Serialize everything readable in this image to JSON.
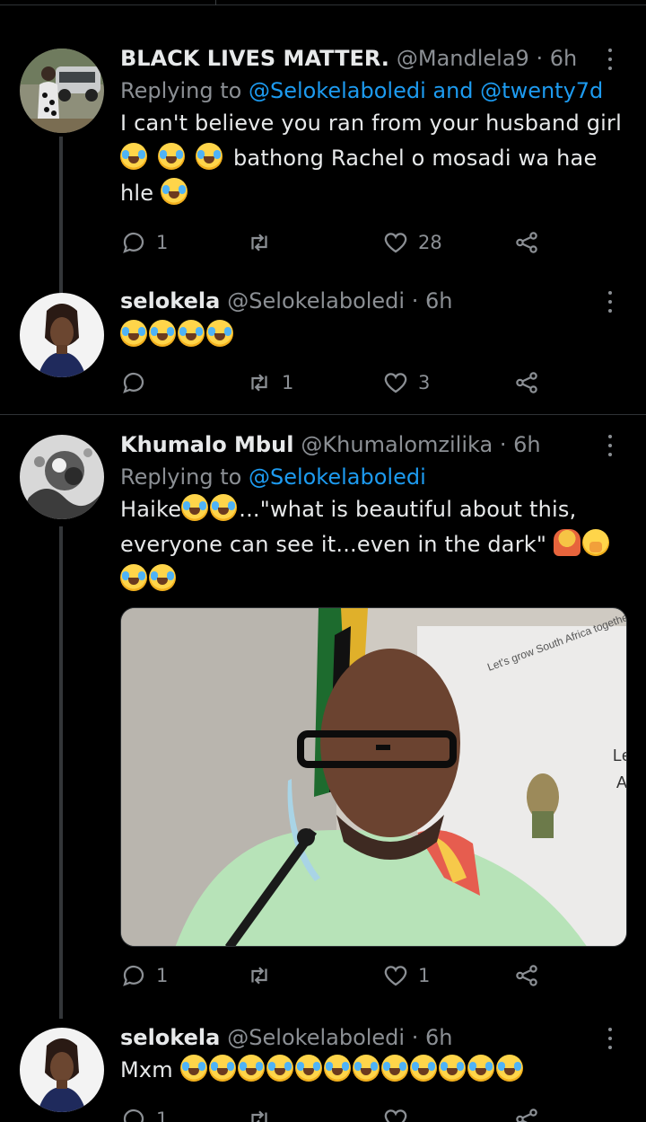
{
  "tweets": [
    {
      "name": "BLACK LIVES MATTER.",
      "handle": "@Mandlela9 · 6h",
      "reply_prefix": "Replying to",
      "reply_mentions": "@Selokelaboledi and @twenty7d",
      "line1": "I can't believe you ran from your husband girl",
      "line2_text": "bathong Rachel o mosadi wa hae",
      "line3_text": "hle",
      "replies": "1",
      "retweets": "",
      "likes": "28"
    },
    {
      "name": "selokela",
      "handle": "@Selokelaboledi · 6h",
      "replies": "",
      "retweets": "1",
      "likes": "3"
    },
    {
      "name": "Khumalo Mbul",
      "handle": "@Khumalomzilika · 6h",
      "reply_prefix": "Replying to",
      "reply_mentions": "@Selokelaboledi",
      "line1_start": "Haike",
      "line1_end": "...\"what is beautiful about this,",
      "line2": "everyone can see it...even in the dark\"",
      "image_text_1": "Let's grow South Africa together",
      "image_text_2": "Le",
      "image_text_3": "A",
      "replies": "1",
      "retweets": "",
      "likes": "1"
    },
    {
      "name": "selokela",
      "handle": "@Selokelaboledi · 6h",
      "text": "Mxm",
      "replies": "1",
      "retweets": "",
      "likes": ""
    }
  ],
  "colors": {
    "background": "#000000",
    "text": "#e7e9ea",
    "muted": "#8b8f94",
    "link": "#1d9bf0",
    "divider": "#2f3336"
  },
  "icons": [
    "reply-icon",
    "retweet-icon",
    "like-icon",
    "share-icon",
    "more-icon",
    "joy-emoji",
    "shrug-emoji",
    "hand-over-mouth-emoji"
  ]
}
